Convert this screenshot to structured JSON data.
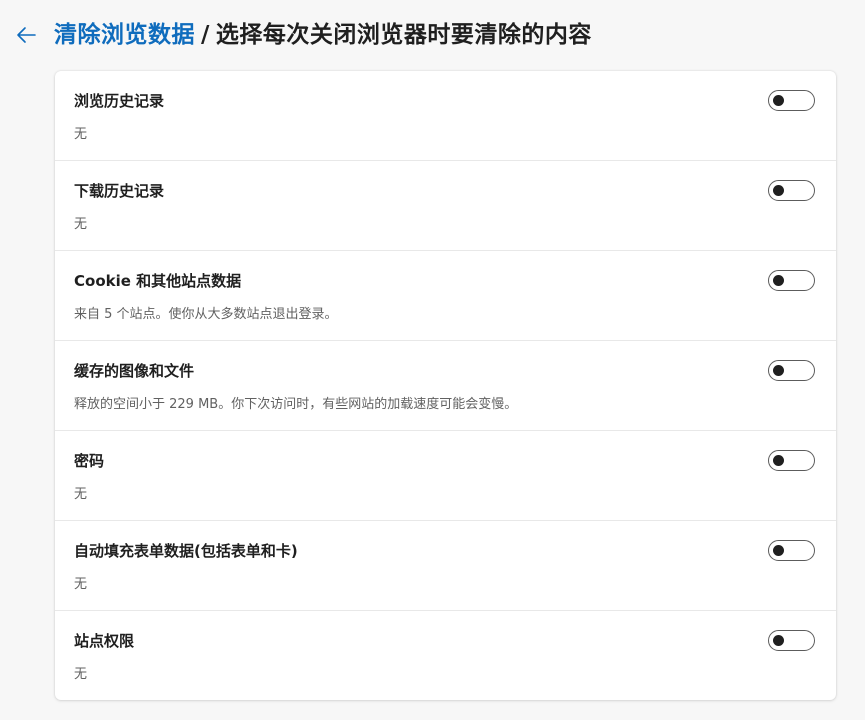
{
  "header": {
    "back_icon": "back-arrow-icon",
    "breadcrumb_parent": "清除浏览数据",
    "separator": "/",
    "title": "选择每次关闭浏览器时要清除的内容"
  },
  "settings": [
    {
      "label": "浏览历史记录",
      "description": "无",
      "enabled": false
    },
    {
      "label": "下载历史记录",
      "description": "无",
      "enabled": false
    },
    {
      "label": "Cookie 和其他站点数据",
      "description": "来自 5 个站点。使你从大多数站点退出登录。",
      "enabled": false
    },
    {
      "label": "缓存的图像和文件",
      "description": "释放的空间小于 229 MB。你下次访问时，有些网站的加载速度可能会变慢。",
      "enabled": false
    },
    {
      "label": "密码",
      "description": "无",
      "enabled": false
    },
    {
      "label": "自动填充表单数据(包括表单和卡)",
      "description": "无",
      "enabled": false
    },
    {
      "label": "站点权限",
      "description": "无",
      "enabled": false
    }
  ],
  "colors": {
    "accent": "#0f6cbd",
    "background": "#f7f7f7",
    "card": "#ffffff",
    "text": "#1f1f1f",
    "secondary_text": "#616161"
  }
}
